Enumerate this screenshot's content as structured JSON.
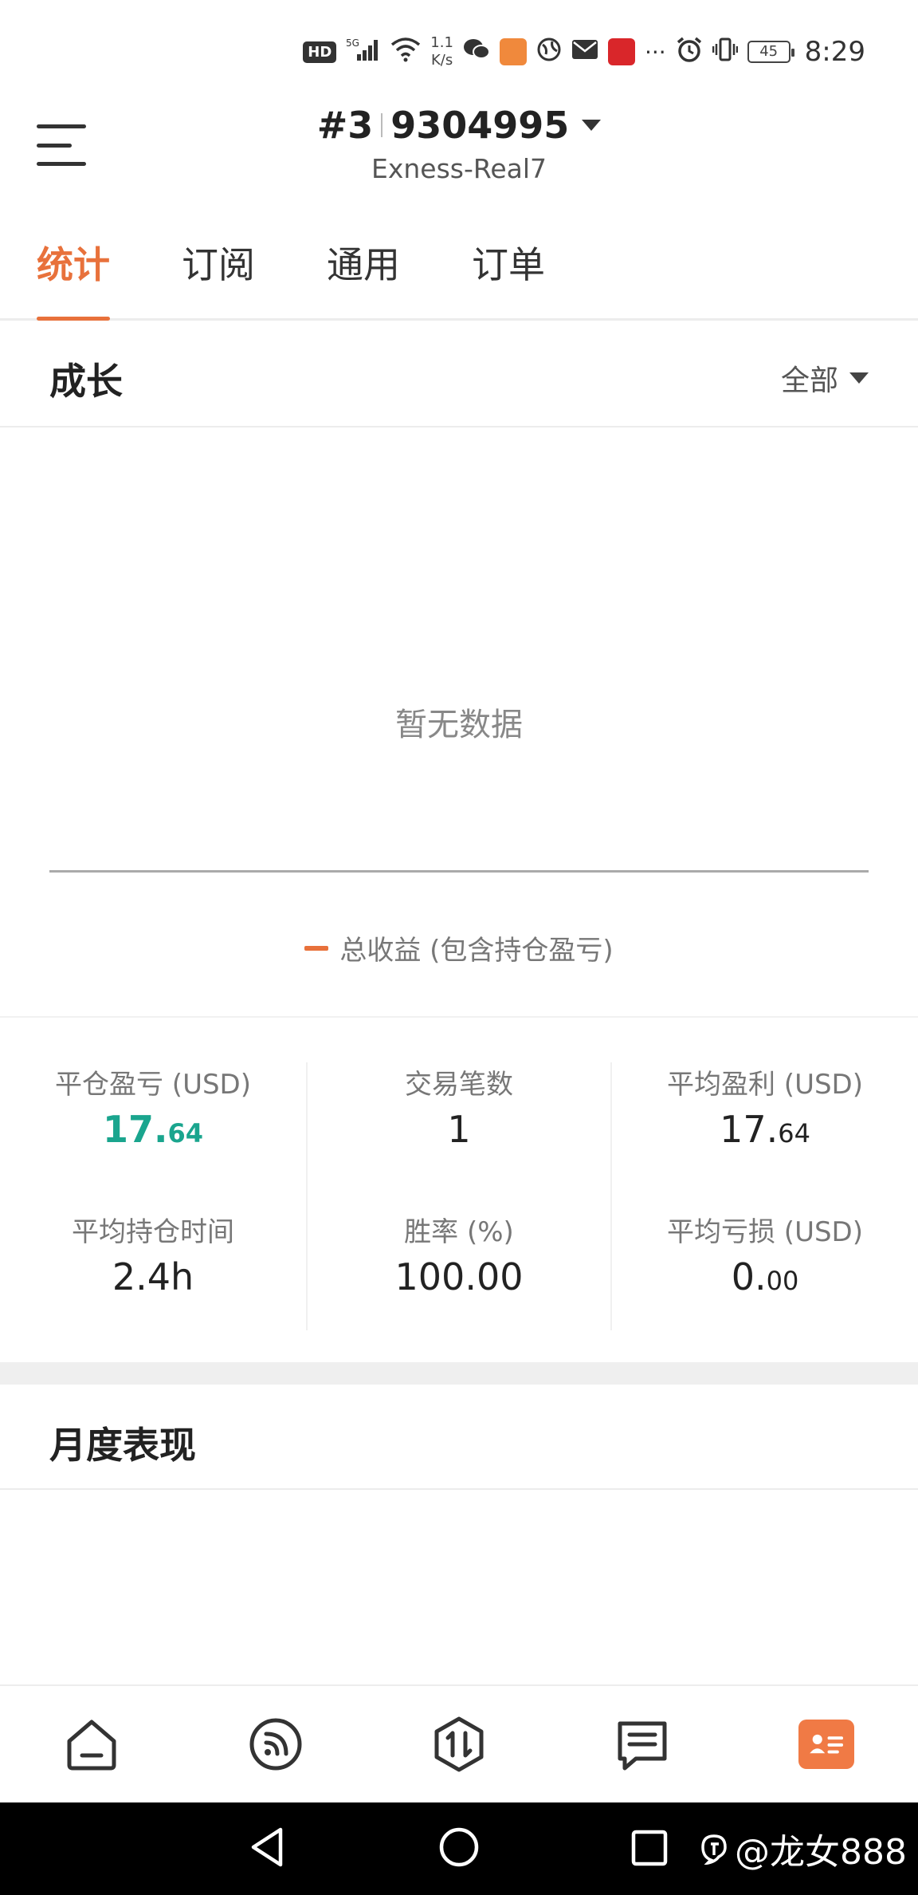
{
  "status_bar": {
    "hd": "HD",
    "signal": "5G",
    "net_speed_value": "1.1",
    "net_speed_unit": "K/s",
    "battery": "45",
    "time": "8:29"
  },
  "header": {
    "account_prefix": "#3",
    "account_number": "9304995",
    "server": "Exness-Real7"
  },
  "tabs": [
    {
      "label": "统计",
      "active": true
    },
    {
      "label": "订阅",
      "active": false
    },
    {
      "label": "通用",
      "active": false
    },
    {
      "label": "订单",
      "active": false
    }
  ],
  "growth": {
    "title": "成长",
    "filter": "全部",
    "no_data": "暂无数据",
    "legend": "总收益 (包含持仓盈亏)"
  },
  "stats": {
    "closed_pnl": {
      "label": "平仓盈亏 (USD)",
      "int": "17.",
      "dec": "64"
    },
    "trades": {
      "label": "交易笔数",
      "value": "1"
    },
    "avg_profit": {
      "label": "平均盈利 (USD)",
      "int": "17.",
      "dec": "64"
    },
    "avg_hold": {
      "label": "平均持仓时间",
      "value": "2.4h"
    },
    "win_rate": {
      "label": "胜率 (%)",
      "value": "100.00"
    },
    "avg_loss": {
      "label": "平均亏损 (USD)",
      "int": "0.",
      "dec": "00"
    }
  },
  "monthly": {
    "title": "月度表现"
  },
  "bottom_nav": [
    {
      "icon": "home-icon"
    },
    {
      "icon": "signal-feed-icon"
    },
    {
      "icon": "trade-icon"
    },
    {
      "icon": "messages-icon"
    },
    {
      "icon": "account-card-icon"
    }
  ],
  "watermark": "@龙女888",
  "colors": {
    "accent": "#e8713b",
    "profit": "#1aa58e"
  }
}
